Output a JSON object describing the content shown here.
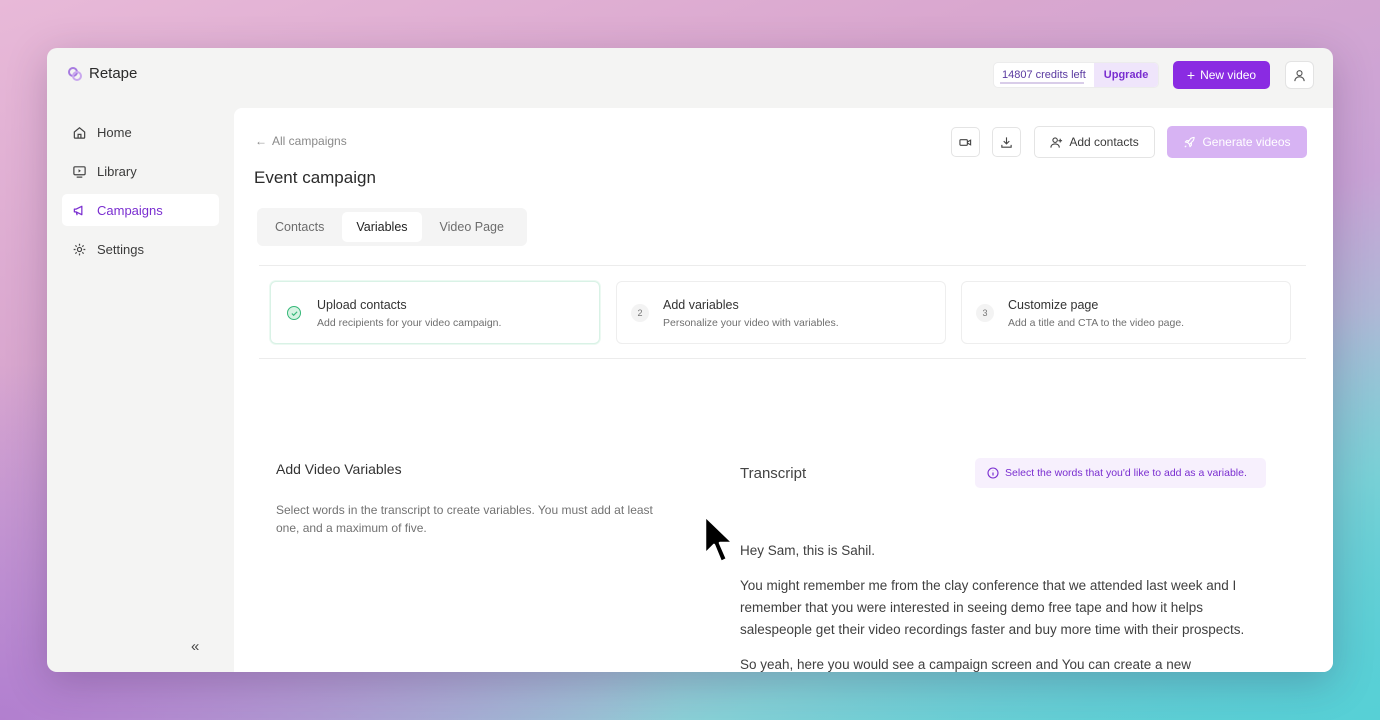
{
  "app": {
    "name": "Retape"
  },
  "header": {
    "credits": "14807 credits left",
    "upgrade": "Upgrade",
    "new_video": "New video",
    "new_video_icon": "plus-icon"
  },
  "sidebar": {
    "items": [
      {
        "label": "Home",
        "icon": "home-icon",
        "active": false
      },
      {
        "label": "Library",
        "icon": "library-icon",
        "active": false
      },
      {
        "label": "Campaigns",
        "icon": "megaphone-icon",
        "active": true
      },
      {
        "label": "Settings",
        "icon": "gear-icon",
        "active": false
      }
    ],
    "collapse": "«"
  },
  "main": {
    "back": "All campaigns",
    "title": "Event campaign",
    "add_contacts": "Add contacts",
    "generate": "Generate videos",
    "tabs": [
      {
        "label": "Contacts",
        "active": false
      },
      {
        "label": "Variables",
        "active": true
      },
      {
        "label": "Video Page",
        "active": false
      }
    ],
    "steps": [
      {
        "num": "",
        "title": "Upload contacts",
        "desc": "Add recipients for your video campaign.",
        "done": true
      },
      {
        "num": "2",
        "title": "Add variables",
        "desc": "Personalize your video with variables.",
        "done": false
      },
      {
        "num": "3",
        "title": "Customize page",
        "desc": "Add a title and CTA to the video page.",
        "done": false
      }
    ],
    "variables": {
      "title": "Add Video Variables",
      "desc": "Select words in the transcript to create variables. You must add at least one, and a maximum of five."
    },
    "transcript": {
      "title": "Transcript",
      "hint": "Select the words that you'd like to add as a variable.",
      "paragraphs": [
        "Hey Sam, this is Sahil.",
        "You might remember me from the clay conference that we attended last week and I remember that you were interested in seeing demo free tape and how it helps salespeople get their video recordings faster and buy more time with their prospects.",
        "So yeah, here you would see a campaign screen and You can create a new"
      ]
    }
  },
  "colors": {
    "accent": "#8a2be2",
    "success": "#35b878"
  }
}
